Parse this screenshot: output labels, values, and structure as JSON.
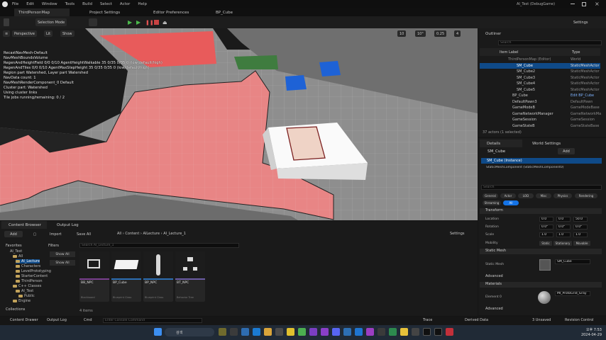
{
  "titlebar": {
    "menus": [
      "File",
      "Edit",
      "Window",
      "Tools",
      "Build",
      "Select",
      "Actor",
      "Help"
    ],
    "window_title": "AI_Test (DebugGame)"
  },
  "tabs": [
    {
      "label": "ThirdPersonMap"
    },
    {
      "label": "Project Settings"
    },
    {
      "label": "Editor Preferences"
    },
    {
      "label": "BP_Cube"
    }
  ],
  "toolbar": {
    "mode": "Selection Mode",
    "settings": "Settings"
  },
  "viewport": {
    "perspective": "Perspective",
    "lit": "Lit",
    "show": "Show",
    "snap_grid": "10",
    "snap_angle": "10°",
    "snap_scale": "0.25",
    "camera_speed": "4",
    "debug_lines": [
      "RecastNavMesh-Default",
      "NavMeshBoundsVolume",
      "RegenAndHeightField 0/0 0/10 AgentHeightWalkable 35 0/35 0/35 0 (low/default/high)",
      "RegenAndTiles 0/0 0/10 AgentMaxStepHeight 35 0/35 0/35 0 (low/default/high)",
      "Region part Watershed, Layer part Watershed",
      "NavData count: 1",
      "NavMeshRenderComponent_0 Default",
      "Cluster part: Watershed",
      "Using cluster links",
      "Tile jobs running/remaining: 0 / 2"
    ]
  },
  "outliner": {
    "title": "Outliner",
    "search_placeholder": "Search",
    "col_label": "Item Label",
    "col_type": "Type",
    "rows": [
      {
        "label": "ThirdPersonMap (Editor)",
        "type": "World"
      },
      {
        "label": "SM_Cube",
        "type": "StaticMeshActor"
      },
      {
        "label": "SM_Cube2",
        "type": "StaticMeshActor"
      },
      {
        "label": "SM_Cube3",
        "type": "StaticMeshActor"
      },
      {
        "label": "SM_Cube4",
        "type": "StaticMeshActor"
      },
      {
        "label": "SM_Cube5",
        "type": "StaticMeshActor"
      },
      {
        "label": "BP_Cube",
        "type": "Edit BP_Cube"
      },
      {
        "label": "DefaultPawn3",
        "type": "DefaultPawn"
      },
      {
        "label": "GameModeB",
        "type": "GameModeBase"
      },
      {
        "label": "GameNetworkManager",
        "type": "GameNetworkMa"
      },
      {
        "label": "GameSession",
        "type": "GameSession"
      },
      {
        "label": "GameStateB",
        "type": "GameStateBase"
      }
    ],
    "status": "37 actors (1 selected)"
  },
  "details": {
    "title": "Details",
    "world_settings": "World Settings",
    "object_name": "SM_Cube",
    "add_label": "Add",
    "component_root": "SM_Cube (Instance)",
    "component_child": "StaticMeshComponent (StaticMeshComponent0)",
    "search_placeholder": "Search",
    "filters": [
      "General",
      "Actor",
      "LOD",
      "Misc",
      "Physics",
      "Rendering",
      "Streaming",
      "All"
    ],
    "sections": {
      "transform": "Transform",
      "static_mesh": "Static Mesh",
      "advanced": "Advanced",
      "materials": "Materials"
    },
    "location_label": "Location",
    "rotation_label": "Rotation",
    "scale_label": "Scale",
    "mobility_label": "Mobility",
    "location": [
      "0.0",
      "0.0",
      "50.0"
    ],
    "rotation": [
      "0.0°",
      "0.0°",
      "0.0°"
    ],
    "scale": [
      "1.0",
      "1.0",
      "1.0"
    ],
    "mobility": [
      "Static",
      "Stationary",
      "Movable"
    ],
    "static_mesh_label": "Static Mesh",
    "static_mesh_value": "SM_Cube",
    "element_label": "Element 0",
    "material_value": "MI_ProtoGrid_Gray"
  },
  "content_browser": {
    "tab": "Content Browser",
    "output_tab": "Output Log",
    "add": "Add",
    "import": "Import",
    "save_all": "Save All",
    "settings": "Settings",
    "path": [
      "All",
      "Content",
      "AILecture",
      "AI_Lecture_1"
    ],
    "filters_label": "Filters",
    "search_placeholder": "Search AI_Lecture_1",
    "favorites": "Favorites",
    "collections": "Collections",
    "show_all": "Show All",
    "show_all2": "Show All",
    "tree": [
      "AI_Test",
      "All",
      "AI_Lecture",
      "Characters",
      "LevelPrototyping",
      "StarterContent",
      "ThirdPerson",
      "C++ Classes",
      "AI_Test",
      "Public",
      "Engine"
    ],
    "assets": [
      {
        "name": "BB_NPC",
        "type": "Blackboard",
        "bar": "#7a3f8f"
      },
      {
        "name": "BP_Cube",
        "type": "Blueprint Class",
        "bar": "#2d6fb4"
      },
      {
        "name": "BP_NPC",
        "type": "Blueprint Class",
        "bar": "#2d6fb4"
      },
      {
        "name": "BT_NPC",
        "type": "Behavior Tree",
        "bar": "#6b5ca5"
      }
    ],
    "item_count": "4 items"
  },
  "bottombar": {
    "content_drawer": "Content Drawer",
    "output_log": "Output Log",
    "cmd": "Cmd",
    "cmd_placeholder": "Enter Console Command",
    "trace": "Trace",
    "derived_data": "Derived Data",
    "unsaved": "3 Unsaved",
    "revision_control": "Revision Control"
  },
  "taskbar": {
    "search": "검색",
    "time": "오후 7:53",
    "date": "2024-04-29"
  }
}
